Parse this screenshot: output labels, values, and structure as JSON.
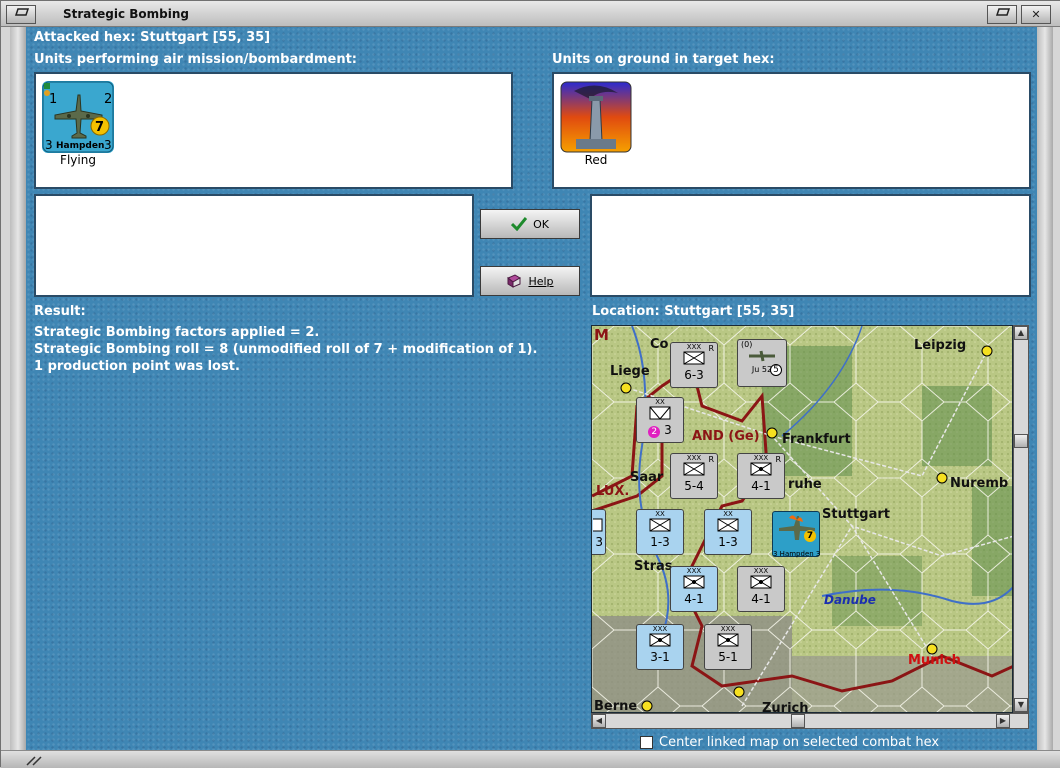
{
  "window": {
    "title": "Strategic Bombing",
    "menu_icon": "window-menu-icon",
    "close_icon": "close-icon",
    "close_glyph": "✕"
  },
  "header": {
    "attacked_hex": "Attacked hex: Stuttgart  [55, 35]"
  },
  "air_units": {
    "label": "Units performing air mission/bombardment:",
    "units": [
      {
        "name": "Hampden",
        "status": "Flying",
        "attack": "1",
        "defense": "2",
        "range_left": "3",
        "range_right": "3",
        "strength": "7",
        "icon": "bomber-plane-icon"
      }
    ]
  },
  "ground_units": {
    "label": "Units on ground in target hex:",
    "units": [
      {
        "status": "Red",
        "icon": "factory-chimney-icon"
      }
    ]
  },
  "buttons": {
    "ok": "OK",
    "help": "Help"
  },
  "result": {
    "label": "Result:",
    "lines": [
      "Strategic Bombing factors applied = 2.",
      "Strategic Bombing roll = 8 (unmodified roll of 7 + modification of 1).",
      "1 production point was lost."
    ]
  },
  "location": {
    "label": "Location:  Stuttgart  [55, 35]"
  },
  "map": {
    "places": [
      "Leipzig",
      "Liege",
      "Frankfurt",
      "Saar",
      "ruhe",
      "Nuremb",
      "Stuttgart",
      "Stras",
      "Danube",
      "Munich",
      "Zurich",
      "Berne",
      "LUX.",
      "AND (Ge)",
      "Co",
      "M"
    ],
    "units": [
      {
        "top": "XXX",
        "value": "6-3",
        "flag": "R"
      },
      {
        "top": "(0)",
        "value": "Ju 52",
        "badge": "5"
      },
      {
        "top": "XX",
        "value": "3",
        "badge": "2"
      },
      {
        "top": "XXX",
        "value": "5-4",
        "flag": "R"
      },
      {
        "top": "XXX",
        "value": "4-1",
        "flag": "R"
      },
      {
        "top": "XX",
        "value": "1-3"
      },
      {
        "top": "XX",
        "value": "1-3"
      },
      {
        "top": "XX",
        "value": "3"
      },
      {
        "top": "XXX",
        "value": "4-1"
      },
      {
        "top": "XXX",
        "value": "4-1"
      },
      {
        "top": "XXX",
        "value": "3-1"
      },
      {
        "top": "XXX",
        "value": "5-1"
      },
      {
        "top": "",
        "value": "3 Hampden 3",
        "badge": "7"
      }
    ]
  },
  "center_map_option": {
    "label": "Center linked map on selected combat hex",
    "checked": false
  },
  "colors": {
    "background": "#3f86b4",
    "panel": "#ffffff",
    "border_river": "#8b1515",
    "unit_blue": "#a9d3ef",
    "unit_gray": "#c9c9c9",
    "air_unit": "#2d9fc8"
  }
}
